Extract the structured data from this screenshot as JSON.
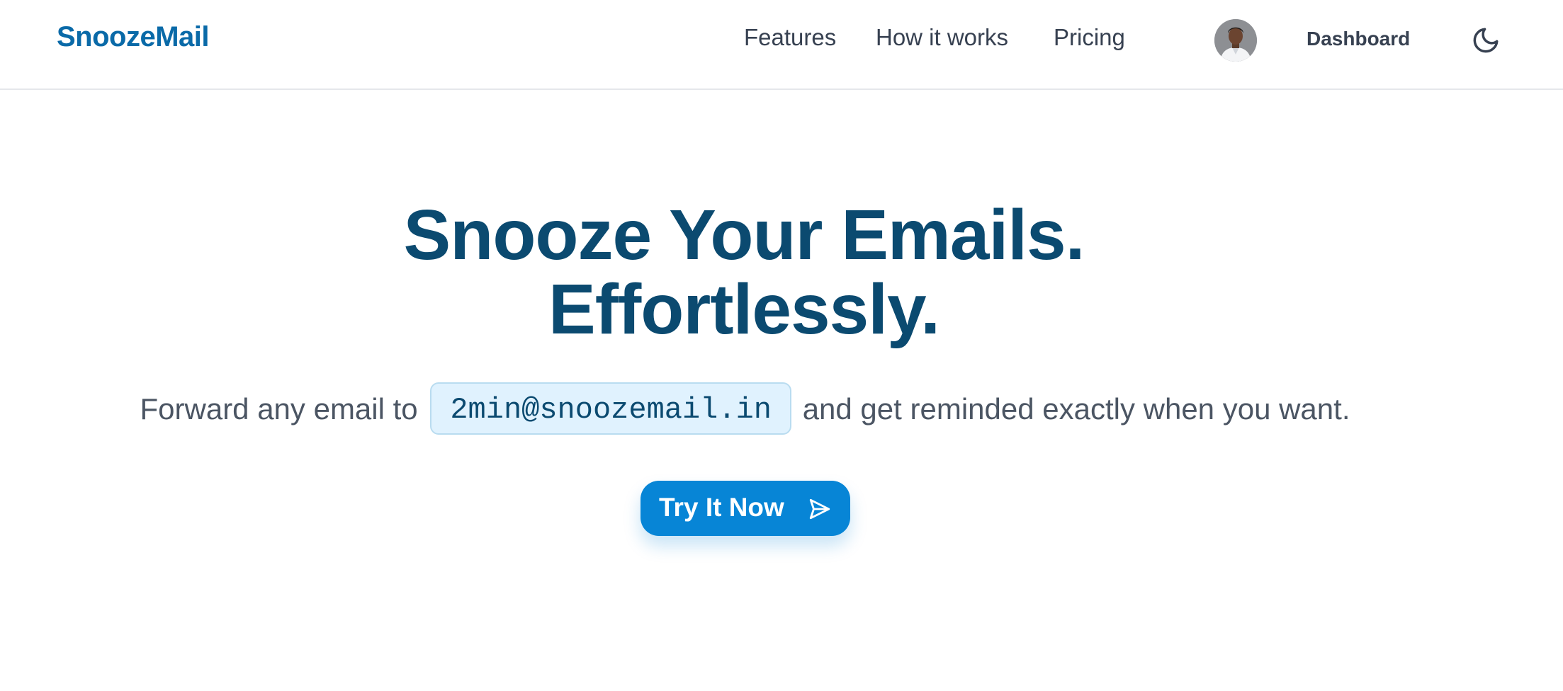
{
  "header": {
    "brand": "SnoozeMail",
    "nav": [
      {
        "label": "Features"
      },
      {
        "label": "How it works"
      },
      {
        "label": "Pricing"
      }
    ],
    "avatar_icon": "user-avatar",
    "dashboard_label": "Dashboard",
    "theme_icon": "moon-icon"
  },
  "hero": {
    "title_line1": "Snooze Your Emails.",
    "title_line2": "Effortlessly.",
    "subtitle_before": "Forward any email to",
    "email": "2min@snoozemail.in",
    "subtitle_after": "and get reminded exactly when you want.",
    "cta_label": "Try It Now",
    "cta_icon": "send-icon"
  },
  "colors": {
    "brand": "#0a6aa8",
    "heading": "#0b4a70",
    "primary": "#0785d6",
    "chip_bg": "#e0f2fe"
  }
}
